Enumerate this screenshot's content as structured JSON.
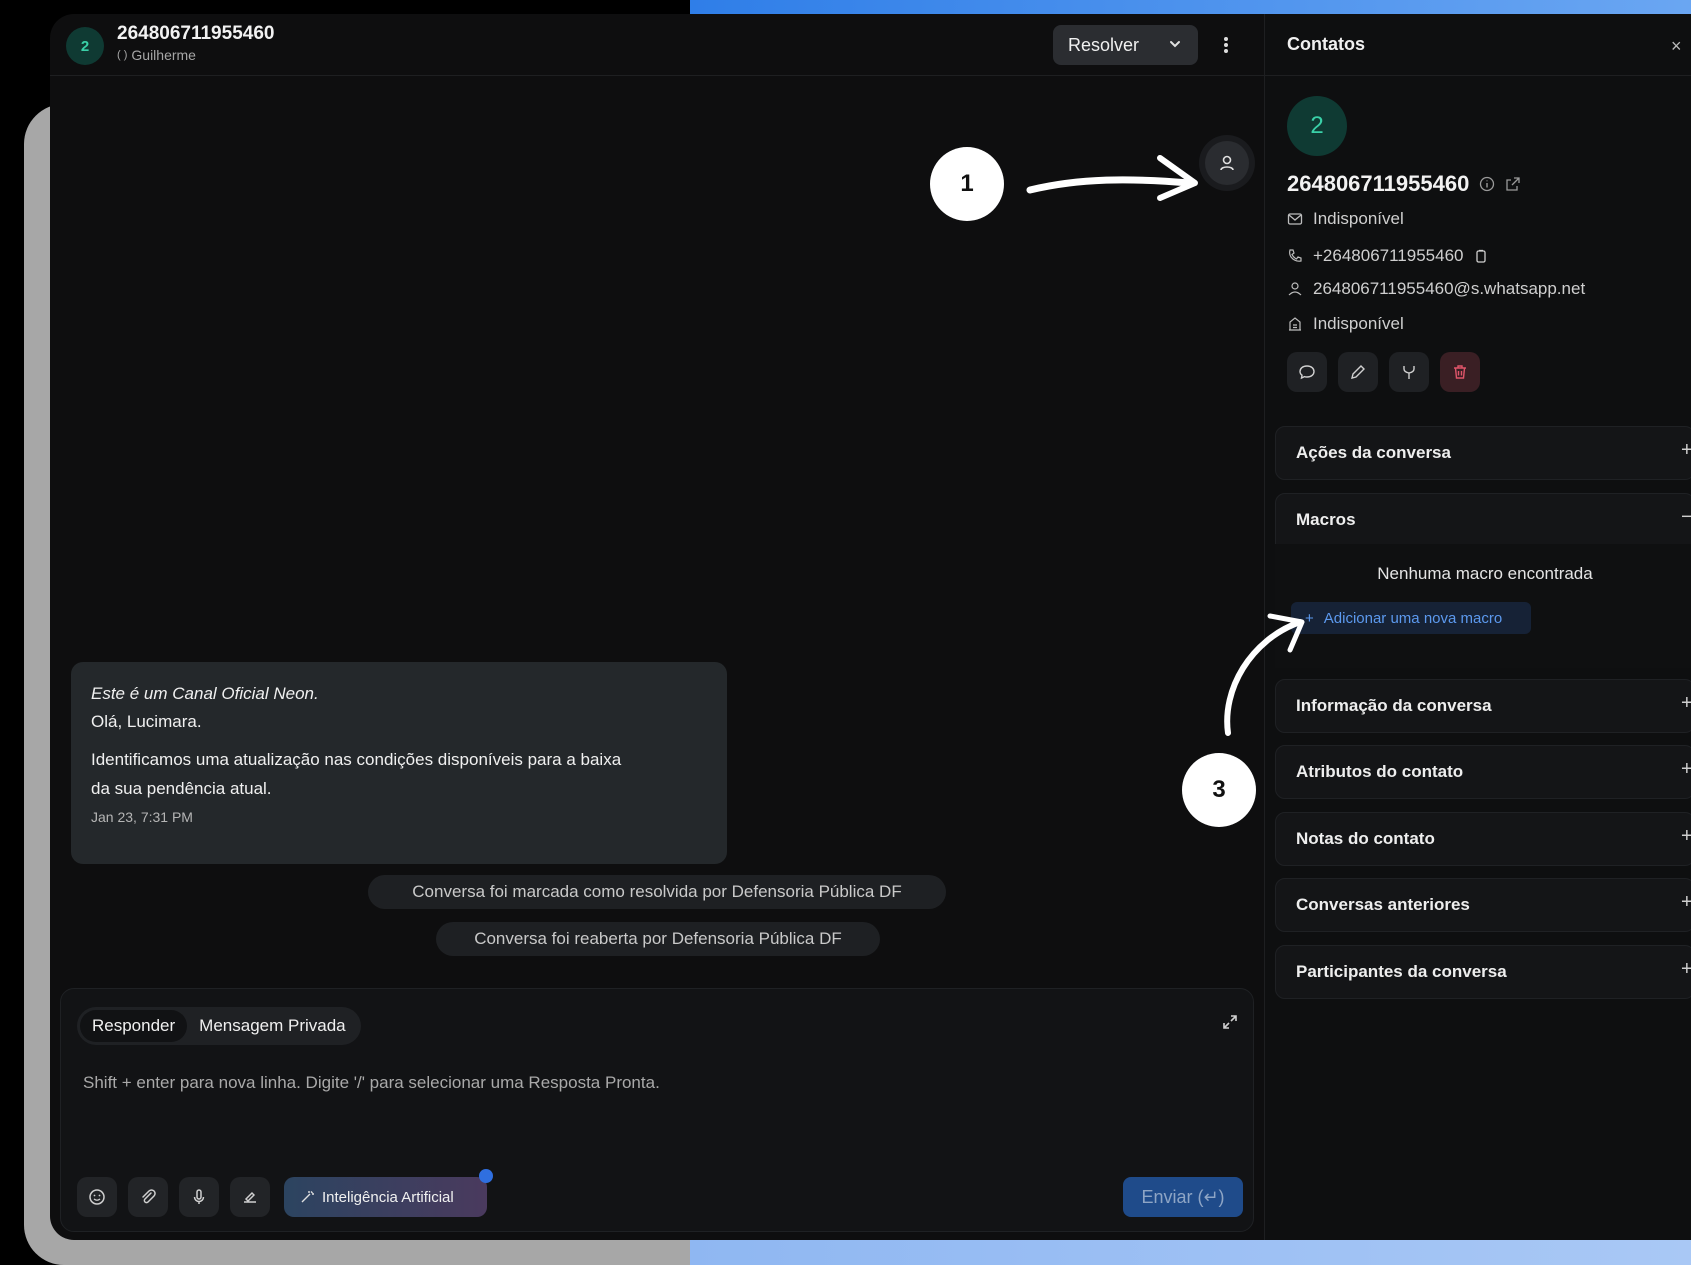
{
  "header": {
    "avatar_letter": "2",
    "title": "264806711955460",
    "subtitle": "Guilherme",
    "resolve_label": "Resolver"
  },
  "message": {
    "line1": "Este é um Canal Oficial Neon.",
    "line2": "Olá, Lucimara.",
    "line3a": "Identificamos uma atualização nas condições disponíveis para a baixa",
    "line3b": "da sua pendência atual.",
    "time": "Jan 23, 7:31 PM"
  },
  "activities": [
    "Conversa foi marcada como resolvida por Defensoria Pública DF",
    "Conversa foi reaberta por Defensoria Pública DF"
  ],
  "composer": {
    "tab_reply": "Responder",
    "tab_private": "Mensagem Privada",
    "placeholder": "Shift + enter para nova linha. Digite '/' para selecionar uma Resposta Pronta.",
    "ai_label": "Inteligência Artificial",
    "send_label": "Enviar (↵)"
  },
  "panel": {
    "title": "Contatos",
    "close": "×",
    "avatar_letter": "2",
    "name": "264806711955460",
    "email": "Indisponível",
    "phone": "+264806711955460",
    "identifier": "264806711955460@s.whatsapp.net",
    "company": "Indisponível",
    "sections": [
      {
        "label": "Ações da conversa",
        "sign": "+"
      },
      {
        "label": "Macros",
        "sign": "−"
      },
      {
        "label": "Informação da conversa",
        "sign": "+"
      },
      {
        "label": "Atributos do contato",
        "sign": "+"
      },
      {
        "label": "Notas do contato",
        "sign": "+"
      },
      {
        "label": "Conversas anteriores",
        "sign": "+"
      },
      {
        "label": "Participantes da conversa",
        "sign": "+"
      }
    ],
    "no_macro": "Nenhuma macro encontrada",
    "add_macro": "Adicionar uma nova macro"
  },
  "annotations": [
    "1",
    "3"
  ],
  "colors": {
    "accent": "#2f6fe0",
    "avatar_bg": "#0f3a33",
    "avatar_fg": "#3ad0a8",
    "danger": "#e0556a"
  }
}
